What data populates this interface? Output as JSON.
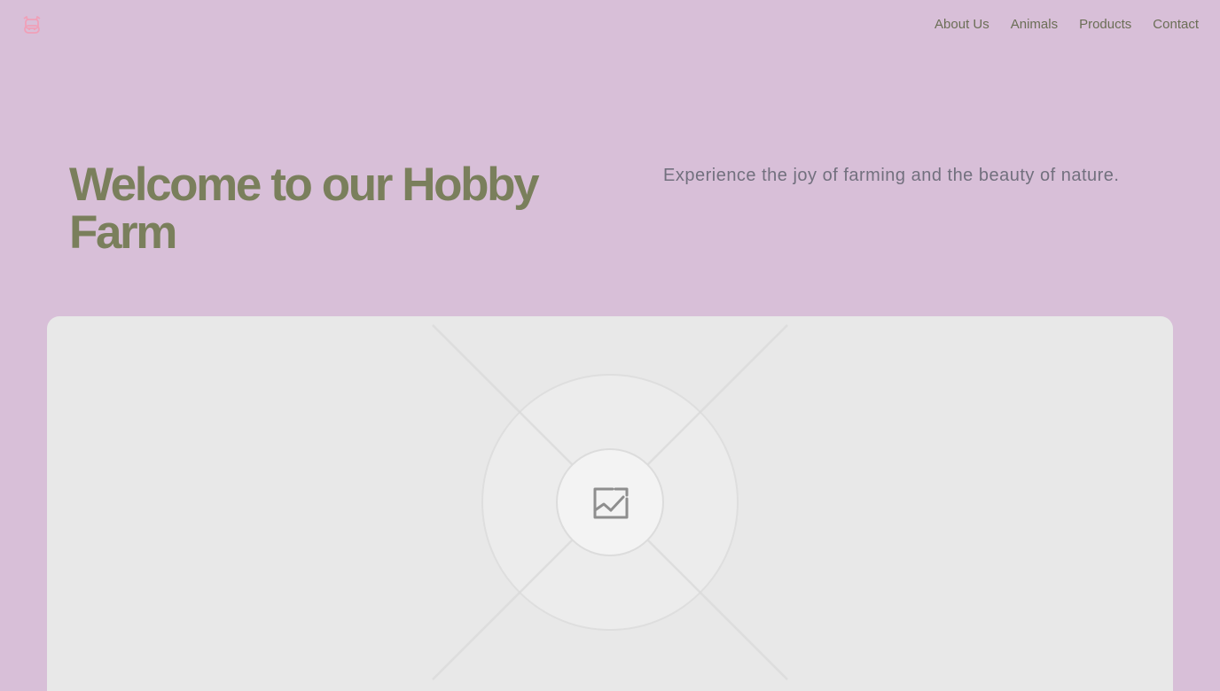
{
  "header": {
    "logo_icon": "cow-face-icon",
    "logo_color": "#f0a0b8",
    "nav": [
      {
        "label": "About Us"
      },
      {
        "label": "Animals"
      },
      {
        "label": "Products"
      },
      {
        "label": "Contact"
      }
    ]
  },
  "hero": {
    "title": "Welcome to our Hobby Farm",
    "subtitle": "Experience the joy of farming and the beauty of nature."
  },
  "image_placeholder": {
    "icon": "image-icon"
  },
  "colors": {
    "background": "#d8bfd8",
    "title": "#7a7f5c",
    "nav_text": "#6b6e56",
    "subtitle": "#72707e",
    "placeholder": "#e8e8e8"
  }
}
